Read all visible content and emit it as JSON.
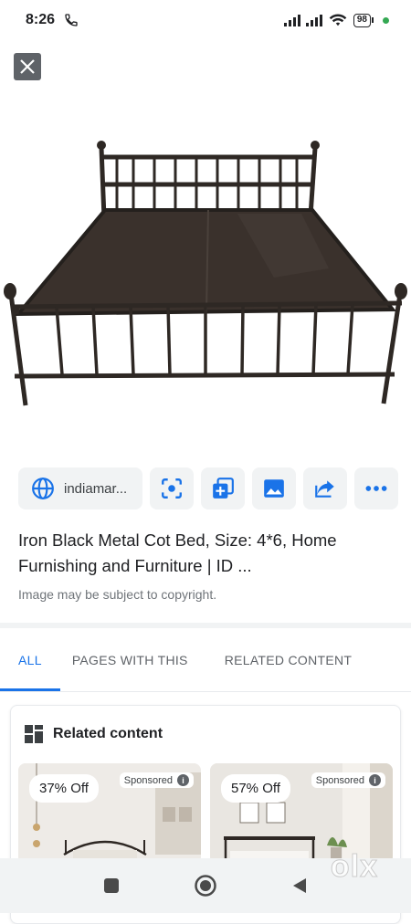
{
  "status_bar": {
    "time": "8:26",
    "battery": "98",
    "icons": [
      "phone-icon",
      "signal-icon",
      "wifi-icon",
      "battery-icon"
    ],
    "dot_color": "#34a853"
  },
  "viewer": {
    "close_icon": "close-icon",
    "image_alt": "Iron Black Metal Cot Bed"
  },
  "actions": {
    "source_label": "indiamar...",
    "buttons": [
      "lens-search-icon",
      "add-to-collection-icon",
      "open-image-icon",
      "share-icon",
      "more-icon"
    ]
  },
  "result": {
    "title": "Iron Black Metal Cot Bed, Size: 4*6, Home Furnishing and Furniture | ID ...",
    "copyright": "Image may be subject to copyright."
  },
  "tabs": [
    {
      "label": "ALL",
      "active": true
    },
    {
      "label": "PAGES WITH THIS",
      "active": false
    },
    {
      "label": "RELATED CONTENT",
      "active": false
    }
  ],
  "related": {
    "heading": "Related content",
    "items": [
      {
        "discount": "37% Off",
        "sponsored": "Sponsored"
      },
      {
        "discount": "57% Off",
        "sponsored": "Sponsored"
      }
    ]
  },
  "watermark": "olx",
  "accent_color": "#1a73e8"
}
